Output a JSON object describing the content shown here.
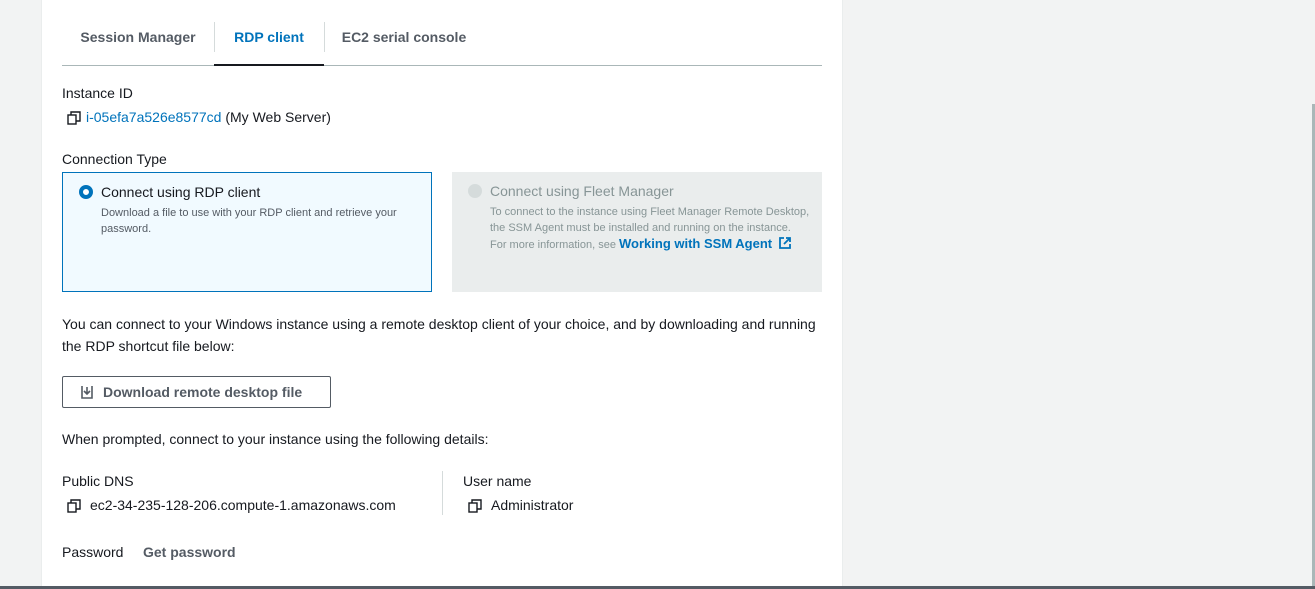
{
  "tabs": [
    {
      "label": "Session Manager"
    },
    {
      "label": "RDP client"
    },
    {
      "label": "EC2 serial console"
    }
  ],
  "instance": {
    "label": "Instance ID",
    "id": "i-05efa7a526e8577cd",
    "name": "(My Web Server)"
  },
  "connection": {
    "label": "Connection Type",
    "options": [
      {
        "title": "Connect using RDP client",
        "description": "Download a file to use with your RDP client and retrieve your password."
      },
      {
        "title": "Connect using Fleet Manager",
        "description": "To connect to the instance using Fleet Manager Remote Desktop, the SSM Agent must be installed and running on the instance. For more information, see",
        "link": "Working with SSM Agent"
      }
    ]
  },
  "intro": "You can connect to your Windows instance using a remote desktop client of your choice, and by downloading and running the RDP shortcut file below:",
  "download_button": "Download remote desktop file",
  "prompt": "When prompted, connect to your instance using the following details:",
  "details": {
    "public_dns_label": "Public DNS",
    "public_dns": "ec2-34-235-128-206.compute-1.amazonaws.com",
    "username_label": "User name",
    "username": "Administrator",
    "password_label": "Password",
    "password_action": "Get password"
  },
  "colors": {
    "accent": "#0073bb",
    "text": "#16191f",
    "muted": "#545b64"
  }
}
